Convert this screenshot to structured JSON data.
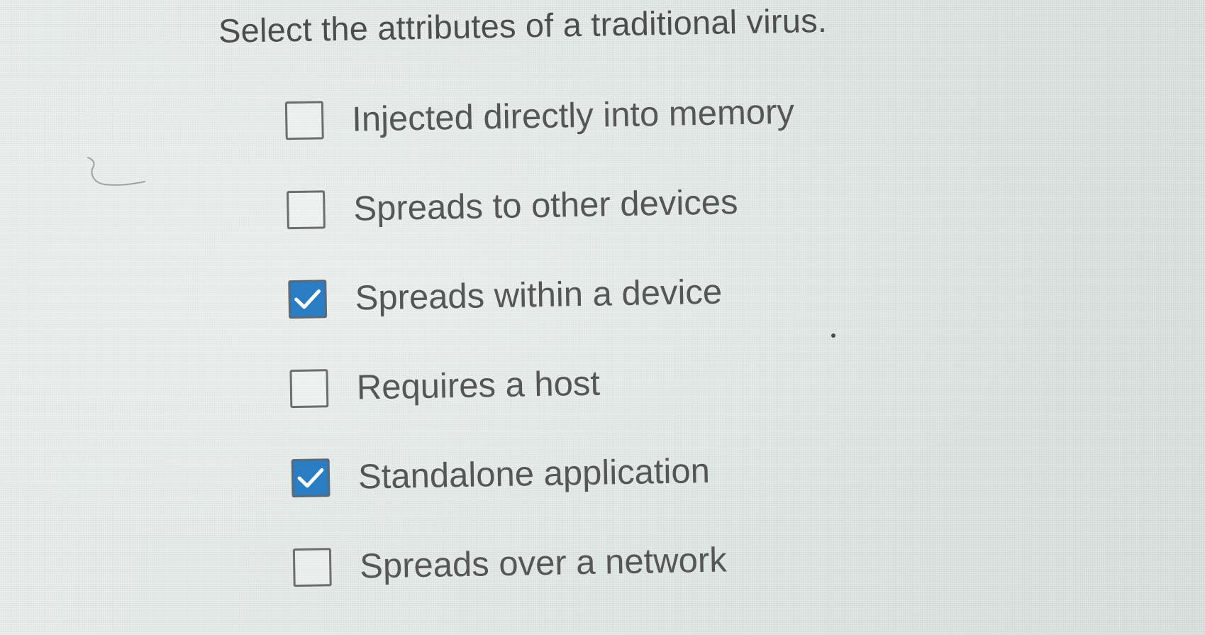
{
  "question": {
    "title": "Select the attributes of a traditional virus."
  },
  "options": [
    {
      "label": "Injected directly into memory",
      "checked": false
    },
    {
      "label": "Spreads to other devices",
      "checked": false
    },
    {
      "label": "Spreads within a device",
      "checked": true
    },
    {
      "label": "Requires a host",
      "checked": false
    },
    {
      "label": "Standalone application",
      "checked": true
    },
    {
      "label": "Spreads over a network",
      "checked": false
    }
  ],
  "colors": {
    "checkbox_checked": "#2a7cc3",
    "checkbox_border": "#6e6e6e",
    "text": "#565656",
    "background": "#e3e9e7"
  },
  "icons": {
    "checked": "check-icon"
  }
}
